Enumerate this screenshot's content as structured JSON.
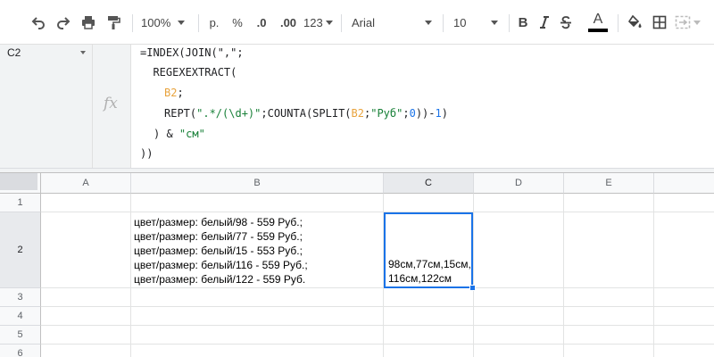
{
  "toolbar": {
    "zoom": "100%",
    "currency": "р.",
    "percent": "%",
    "decrease_decimals": ".0",
    "increase_decimals": ".00",
    "more_formats": "123",
    "font_family": "Arial",
    "font_size": "10",
    "bold": "B",
    "text_color": "A",
    "text_color_swatch": "#000000"
  },
  "name_box": {
    "value": "C2"
  },
  "formula_bar": {
    "fx": "fx",
    "lines": {
      "l1": "=INDEX(JOIN(\",\";",
      "l2": "  REGEXEXTRACT(",
      "l3_ref": "B2",
      "l3_semi": ";",
      "l4a": "REPT(",
      "l4_str": "\".*/(\\d+)\"",
      "l4b": ";COUNTA(SPLIT(",
      "l4_ref": "B2",
      "l4c": ";",
      "l4_str2": "\"Руб\"",
      "l4d": ";",
      "l4_num": "0",
      "l4e": "))-",
      "l4_num2": "1",
      "l4f": ")",
      "l5a": ") & ",
      "l5_str": "\"см\"",
      "l6": "))"
    }
  },
  "sheet": {
    "columns": [
      "A",
      "B",
      "C",
      "D",
      "E"
    ],
    "rows": [
      "1",
      "2",
      "3",
      "4",
      "5",
      "6"
    ],
    "cells": {
      "B2": [
        "цвет/размер: белый/98 - 559 Руб.;",
        "цвет/размер: белый/77 - 559 Руб.;",
        "цвет/размер: белый/15 - 553 Руб.;",
        "цвет/размер: белый/116 - 559 Руб.;",
        "цвет/размер: белый/122 - 559 Руб."
      ],
      "C2": "98см,77см,15см,116см,122см"
    },
    "selected_cell": "C2",
    "selection_color": "#1a73e8"
  }
}
